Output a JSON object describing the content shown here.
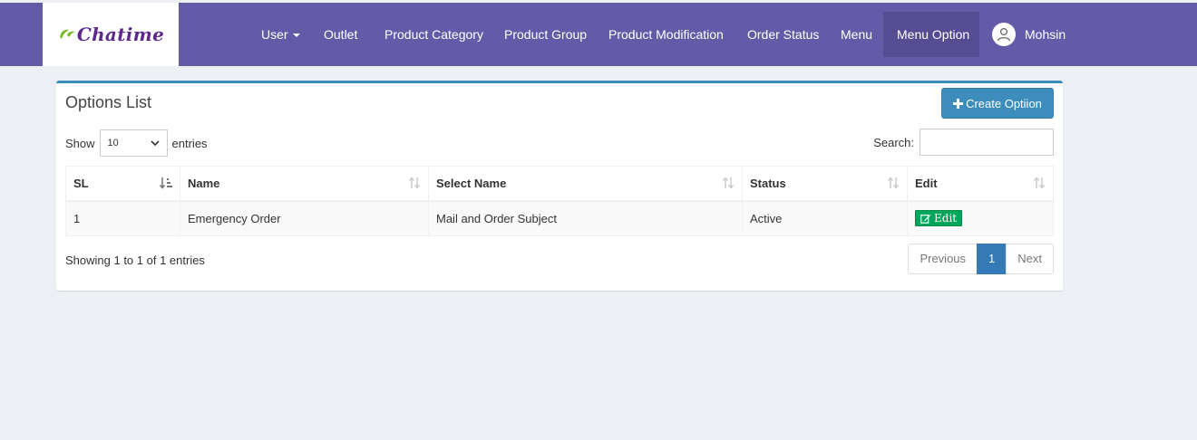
{
  "brand": {
    "name": "Chatime",
    "logo_icon": "leaf-icon"
  },
  "nav": {
    "items": [
      {
        "label": "User",
        "has_dropdown": true
      },
      {
        "label": "Outlet"
      },
      {
        "label": "Product Category"
      },
      {
        "label": "Product Group"
      },
      {
        "label": "Product Modification"
      },
      {
        "label": "Order Status"
      },
      {
        "label": "Menu"
      },
      {
        "label": "Menu Option",
        "active": true
      }
    ],
    "user": {
      "name": "Mohsin",
      "avatar_icon": "user-avatar-icon"
    }
  },
  "panel": {
    "title": "Options List",
    "create_button": {
      "icon": "plus-icon",
      "label": "Create Optiion"
    }
  },
  "length": {
    "show_label": "Show",
    "selected": "10",
    "entries_label": "entries"
  },
  "search": {
    "label": "Search:",
    "value": ""
  },
  "table": {
    "columns": [
      "SL",
      "Name",
      "Select Name",
      "Status",
      "Edit"
    ],
    "sorted_column": "SL",
    "rows": [
      {
        "sl": "1",
        "name": "Emergency Order",
        "select_name": "Mail and Order Subject",
        "status": "Active",
        "edit_label": "Edit",
        "edit_icon": "edit-icon"
      }
    ]
  },
  "info": "Showing 1 to 1 of 1 entries",
  "pagination": {
    "previous": "Previous",
    "current": "1",
    "next": "Next"
  },
  "colors": {
    "topbar": "#645ba8",
    "nav_active": "#554c93",
    "primary": "#3c8dbc",
    "success": "#00a65a",
    "page_active": "#337ab7",
    "background": "#eceff3"
  }
}
